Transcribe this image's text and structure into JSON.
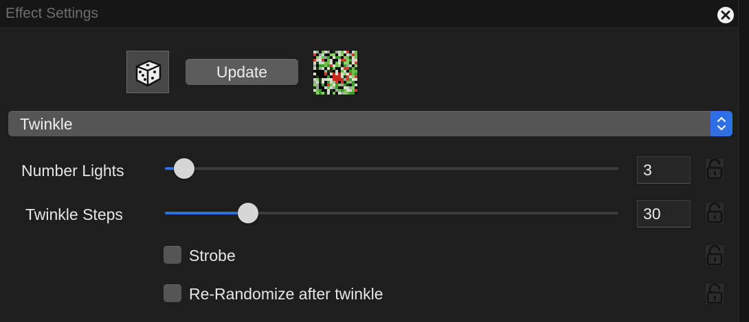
{
  "window": {
    "title": "Effect Settings"
  },
  "toolbar": {
    "randomize_icon": "dice-icon",
    "update_label": "Update",
    "preview_icon": "effect-preview-thumbnail"
  },
  "effect_select": {
    "selected": "Twinkle"
  },
  "settings": {
    "number_lights": {
      "label": "Number Lights",
      "value": "3",
      "slider_fraction": 0.02
    },
    "twinkle_steps": {
      "label": "Twinkle Steps",
      "value": "30",
      "slider_fraction": 0.16
    },
    "strobe": {
      "label": "Strobe",
      "checked": false
    },
    "rerandomize": {
      "label": "Re-Randomize after twinkle",
      "checked": false
    }
  },
  "colors": {
    "accent": "#2f6fe4",
    "background": "#1e1e1e"
  }
}
